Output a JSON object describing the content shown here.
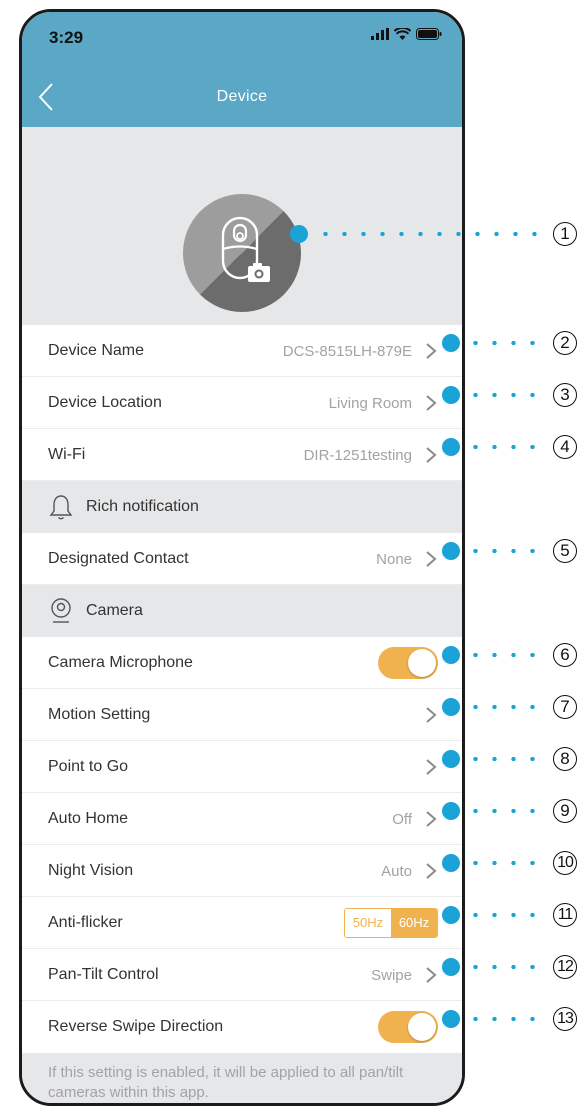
{
  "status": {
    "time": "3:29"
  },
  "nav": {
    "title": "Device"
  },
  "rows_basic": [
    {
      "label": "Device Name",
      "value": "DCS-8515LH-879E"
    },
    {
      "label": "Device Location",
      "value": "Living Room"
    },
    {
      "label": "Wi-Fi",
      "value": "DIR-1251testing"
    }
  ],
  "section_rich": {
    "label": "Rich notification"
  },
  "designated": {
    "label": "Designated Contact",
    "value": "None"
  },
  "section_camera": {
    "label": "Camera"
  },
  "camera_rows": {
    "microphone": {
      "label": "Camera Microphone",
      "enabled": true
    },
    "motion": {
      "label": "Motion Setting"
    },
    "point_to_go": {
      "label": "Point to Go"
    },
    "auto_home": {
      "label": "Auto Home",
      "value": "Off"
    },
    "night_vision": {
      "label": "Night Vision",
      "value": "Auto"
    },
    "anti_flicker": {
      "label": "Anti-flicker",
      "options": [
        "50Hz",
        "60Hz"
      ],
      "selected": "60Hz"
    },
    "pan_tilt": {
      "label": "Pan-Tilt Control",
      "value": "Swipe"
    },
    "reverse_swipe": {
      "label": "Reverse Swipe Direction",
      "enabled": true
    }
  },
  "footer_note": "If this setting is enabled, it will be applied to all pan/tilt cameras within this app.",
  "callout_numbers": [
    "1",
    "2",
    "3",
    "4",
    "5",
    "6",
    "7",
    "8",
    "9",
    "10",
    "11",
    "12",
    "13"
  ],
  "colors": {
    "header": "#5aa8c5",
    "accent": "#f0b24e",
    "callout": "#1aa3d6",
    "section_bg": "#e6e7e9"
  },
  "icons": {
    "back": "chevron-left-icon",
    "bell": "bell-icon",
    "camera": "camera-icon",
    "row_arrow": "chevron-right-icon"
  }
}
